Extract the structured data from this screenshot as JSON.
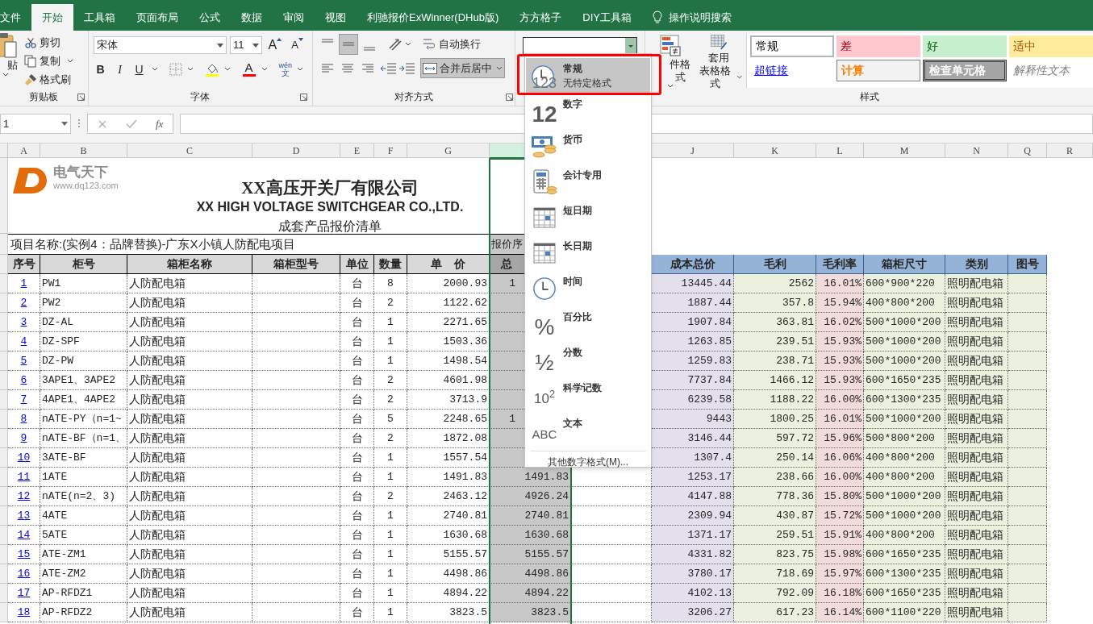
{
  "tabs": [
    {
      "label": "文件",
      "selected": false
    },
    {
      "label": "开始",
      "selected": true
    },
    {
      "label": "工具箱",
      "selected": false
    },
    {
      "label": "页面布局",
      "selected": false
    },
    {
      "label": "公式",
      "selected": false
    },
    {
      "label": "数据",
      "selected": false
    },
    {
      "label": "审阅",
      "selected": false
    },
    {
      "label": "视图",
      "selected": false
    },
    {
      "label": "利驰报价ExWinner(DHub版)",
      "selected": false
    },
    {
      "label": "方方格子",
      "selected": false
    },
    {
      "label": "DIY工具箱",
      "selected": false
    }
  ],
  "tell_me": "操作说明搜索",
  "ribbon": {
    "clipboard": {
      "paste": "贴",
      "cut": "剪切",
      "copy": "复制",
      "format_painter": "格式刷",
      "label": "剪贴板"
    },
    "font": {
      "name": "宋体",
      "size": "11",
      "grow": "A",
      "shrink": "A",
      "bold": "B",
      "italic": "I",
      "underline": "U",
      "font_color": "A",
      "phonetic_pinyin": "wén",
      "phonetic_char": "文",
      "label": "字体"
    },
    "alignment": {
      "wrap": "自动换行",
      "merge": "合并后居中",
      "label": "对齐方式"
    },
    "styles": {
      "conditional": "件格式",
      "table_line1": "套用",
      "table_line2": "表格格式",
      "label": "样式",
      "cells": [
        {
          "label": "常规",
          "kind": "normal"
        },
        {
          "label": "差",
          "kind": "bad"
        },
        {
          "label": "好",
          "kind": "good"
        },
        {
          "label": "适中",
          "kind": "neutral"
        },
        {
          "label": "超链接",
          "kind": "hyperlink"
        },
        {
          "label": "计算",
          "kind": "calculation"
        },
        {
          "label": "检查单元格",
          "kind": "check"
        },
        {
          "label": "解释性文本",
          "kind": "explanatory"
        }
      ]
    }
  },
  "formula_bar": {
    "name_box": "1",
    "fx": "fx"
  },
  "column_headers": [
    {
      "label": "A",
      "selected": false
    },
    {
      "label": "B",
      "selected": false
    },
    {
      "label": "C",
      "selected": false
    },
    {
      "label": "D",
      "selected": false
    },
    {
      "label": "E",
      "selected": false
    },
    {
      "label": "F",
      "selected": false
    },
    {
      "label": "G",
      "selected": false
    },
    {
      "selected": true
    },
    {
      "label": "J",
      "selected": false
    },
    {
      "label": "K",
      "selected": false
    },
    {
      "label": "L",
      "selected": false
    },
    {
      "label": "M",
      "selected": false
    },
    {
      "label": "N",
      "selected": false
    },
    {
      "label": "Q",
      "selected": false
    },
    {
      "label": "R",
      "selected": false
    }
  ],
  "sheet": {
    "logo": {
      "name": "电气天下",
      "url": "www.dq123.com"
    },
    "title": "XX高压开关厂有限公司",
    "title_en": "XX HIGH VOLTAGE SWITCHGEAR CO.,LTD.",
    "subtitle": "成套产品报价清单",
    "project": "项目名称:(实例4：品牌替换)-广东X小镇人防配电项目",
    "quote_label": "报价序",
    "headers_left": [
      "序号",
      "柜号",
      "箱柜名称",
      "箱柜型号",
      "单位",
      "数量",
      "单    价"
    ],
    "header_total": "总",
    "headers_right": [
      "成本总价",
      "毛利",
      "毛利率",
      "箱柜尺寸",
      "类别",
      "图号"
    ],
    "rows": [
      {
        "no": "1",
        "code": "PW1",
        "name": "人防配电箱",
        "unit": "台",
        "qty": "8",
        "price": "2000.93",
        "total": "1",
        "total_covered": true,
        "cost": "13445.44",
        "profit": "2562",
        "rate": "16.01%",
        "size": "600*900*220",
        "category": "照明配电箱"
      },
      {
        "no": "2",
        "code": "PW2",
        "name": "人防配电箱",
        "unit": "台",
        "qty": "2",
        "price": "1122.62",
        "cost": "1887.44",
        "profit": "357.8",
        "rate": "15.94%",
        "size": "400*800*200",
        "category": "照明配电箱"
      },
      {
        "no": "3",
        "code": "DZ-AL",
        "name": "人防配电箱",
        "unit": "台",
        "qty": "1",
        "price": "2271.65",
        "cost": "1907.84",
        "profit": "363.81",
        "rate": "16.02%",
        "size": "500*1000*200",
        "category": "照明配电箱"
      },
      {
        "no": "4",
        "code": "DZ-SPF",
        "name": "人防配电箱",
        "unit": "台",
        "qty": "1",
        "price": "1503.36",
        "cost": "1263.85",
        "profit": "239.51",
        "rate": "15.93%",
        "size": "500*1000*200",
        "category": "照明配电箱"
      },
      {
        "no": "5",
        "code": "DZ-PW",
        "name": "人防配电箱",
        "unit": "台",
        "qty": "1",
        "price": "1498.54",
        "cost": "1259.83",
        "profit": "238.71",
        "rate": "15.93%",
        "size": "500*1000*200",
        "category": "照明配电箱"
      },
      {
        "no": "6",
        "code": "3APE1、3APE2",
        "name": "人防配电箱",
        "unit": "台",
        "qty": "2",
        "price": "4601.98",
        "cost": "7737.84",
        "profit": "1466.12",
        "rate": "15.93%",
        "size": "600*1650*235",
        "category": "照明配电箱"
      },
      {
        "no": "7",
        "code": "4APE1、4APE2",
        "name": "人防配电箱",
        "unit": "台",
        "qty": "2",
        "price": "3713.9",
        "cost": "6239.58",
        "profit": "1188.22",
        "rate": "16.00%",
        "size": "600*1300*235",
        "category": "照明配电箱"
      },
      {
        "no": "8",
        "code": "nATE-PY（n=1~",
        "name": "人防配电箱",
        "unit": "台",
        "qty": "5",
        "price": "2248.65",
        "total": "1",
        "total_covered": true,
        "cost": "9443",
        "profit": "1800.25",
        "rate": "16.01%",
        "size": "500*1000*200",
        "category": "照明配电箱"
      },
      {
        "no": "9",
        "code": "nATE-BF（n=1、",
        "name": "人防配电箱",
        "unit": "台",
        "qty": "2",
        "price": "1872.08",
        "cost": "3146.44",
        "profit": "597.72",
        "rate": "15.96%",
        "size": "500*800*200",
        "category": "照明配电箱"
      },
      {
        "no": "10",
        "code": "3ATE-BF",
        "name": "人防配电箱",
        "unit": "台",
        "qty": "1",
        "price": "1557.54",
        "cost": "1307.4",
        "profit": "250.14",
        "rate": "16.06%",
        "size": "400*800*200",
        "category": "照明配电箱"
      },
      {
        "no": "11",
        "code": "1ATE",
        "name": "人防配电箱",
        "unit": "台",
        "qty": "1",
        "price": "1491.83",
        "total": "1491.83",
        "total_covered": false,
        "cost": "1253.17",
        "profit": "238.66",
        "rate": "16.00%",
        "size": "400*800*200",
        "category": "照明配电箱"
      },
      {
        "no": "12",
        "code": "nATE(n=2、3)",
        "name": "人防配电箱",
        "unit": "台",
        "qty": "2",
        "price": "2463.12",
        "total": "4926.24",
        "total_covered": false,
        "cost": "4147.88",
        "profit": "778.36",
        "rate": "15.80%",
        "size": "500*1000*200",
        "category": "照明配电箱"
      },
      {
        "no": "13",
        "code": "4ATE",
        "name": "人防配电箱",
        "unit": "台",
        "qty": "1",
        "price": "2740.81",
        "total": "2740.81",
        "total_covered": false,
        "cost": "2309.94",
        "profit": "430.87",
        "rate": "15.72%",
        "size": "500*1000*200",
        "category": "照明配电箱"
      },
      {
        "no": "14",
        "code": "5ATE",
        "name": "人防配电箱",
        "unit": "台",
        "qty": "1",
        "price": "1630.68",
        "total": "1630.68",
        "total_covered": false,
        "cost": "1371.17",
        "profit": "259.51",
        "rate": "15.91%",
        "size": "400*800*200",
        "category": "照明配电箱"
      },
      {
        "no": "15",
        "code": "ATE-ZM1",
        "name": "人防配电箱",
        "unit": "台",
        "qty": "1",
        "price": "5155.57",
        "total": "5155.57",
        "total_covered": false,
        "cost": "4331.82",
        "profit": "823.75",
        "rate": "15.98%",
        "size": "600*1650*235",
        "category": "照明配电箱"
      },
      {
        "no": "16",
        "code": "ATE-ZM2",
        "name": "人防配电箱",
        "unit": "台",
        "qty": "1",
        "price": "4498.86",
        "total": "4498.86",
        "total_covered": false,
        "cost": "3780.17",
        "profit": "718.69",
        "rate": "15.97%",
        "size": "600*1300*235",
        "category": "照明配电箱"
      },
      {
        "no": "17",
        "code": "AP-RFDZ1",
        "name": "人防配电箱",
        "unit": "台",
        "qty": "1",
        "price": "4894.22",
        "total": "4894.22",
        "total_covered": false,
        "cost": "4102.13",
        "profit": "792.09",
        "rate": "16.18%",
        "size": "600*1650*235",
        "category": "照明配电箱"
      },
      {
        "no": "18",
        "code": "AP-RFDZ2",
        "name": "人防配电箱",
        "unit": "台",
        "qty": "1",
        "price": "3823.5",
        "total": "3823.5",
        "total_covered": false,
        "cost": "3206.27",
        "profit": "617.23",
        "rate": "16.14%",
        "size": "600*1100*220",
        "category": "照明配电箱"
      }
    ]
  },
  "number_format_menu": {
    "items": [
      {
        "label": "常规",
        "sublabel": "无特定格式",
        "glyph": "123",
        "selected": true
      },
      {
        "label": "数字",
        "glyph": "12",
        "selected": false
      },
      {
        "label": "货币",
        "selected": false
      },
      {
        "label": "会计专用",
        "selected": false
      },
      {
        "label": "短日期",
        "selected": false
      },
      {
        "label": "长日期",
        "selected": false
      },
      {
        "label": "时间",
        "selected": false
      },
      {
        "label": "百分比",
        "glyph": "%",
        "selected": false
      },
      {
        "label": "分数",
        "glyph": "½",
        "selected": false
      },
      {
        "label": "科学记数",
        "glyph": "10$^{2}$",
        "selected": false
      },
      {
        "label": "文本",
        "glyph": "ABC",
        "selected": false
      }
    ],
    "more": "其他数字格式(M)..."
  }
}
